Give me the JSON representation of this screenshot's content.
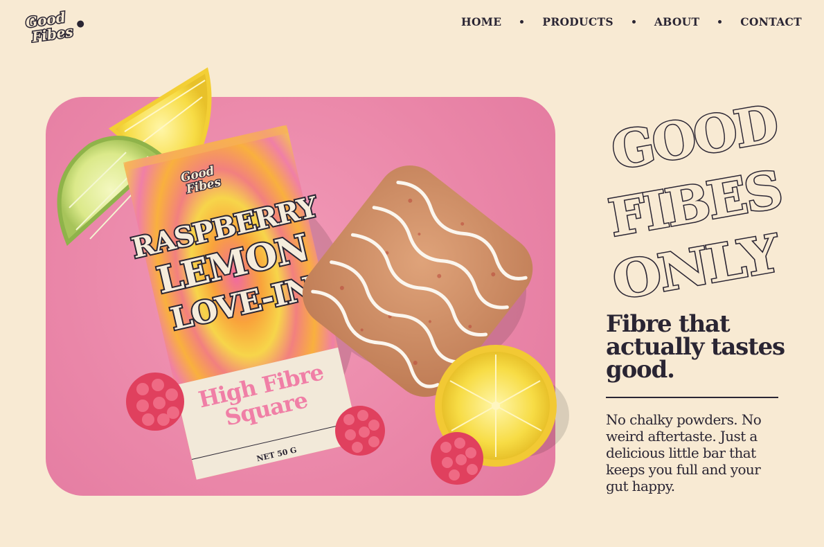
{
  "brand": {
    "logo_line1": "Good",
    "logo_line2": "Fibes"
  },
  "nav": {
    "items": [
      "HOME",
      "PRODUCTS",
      "ABOUT",
      "CONTACT"
    ]
  },
  "hero": {
    "pack": {
      "brand_line1": "Good",
      "brand_line2": "Fibes",
      "flavor_line1": "RASPBERRY",
      "flavor_line2": "LEMON",
      "flavor_line3": "LOVE-IN",
      "product_line1": "High Fibre",
      "product_line2": "Square",
      "net_weight": "NET 50 G"
    }
  },
  "headline": {
    "line1": "GOOD",
    "line2": "FIBES",
    "line3": "ONLY"
  },
  "tagline": "Fibre that actually tastes good.",
  "body": "No chalky powders. No weird aftertaste. Just a delicious little bar that keeps you full and your gut happy.",
  "colors": {
    "background": "#f8ead3",
    "ink": "#2a2533",
    "pink_panel": "#ea86a8",
    "pack_pink": "#f07fa6",
    "lemon": "#f5d43a",
    "raspberry": "#e0405e"
  }
}
